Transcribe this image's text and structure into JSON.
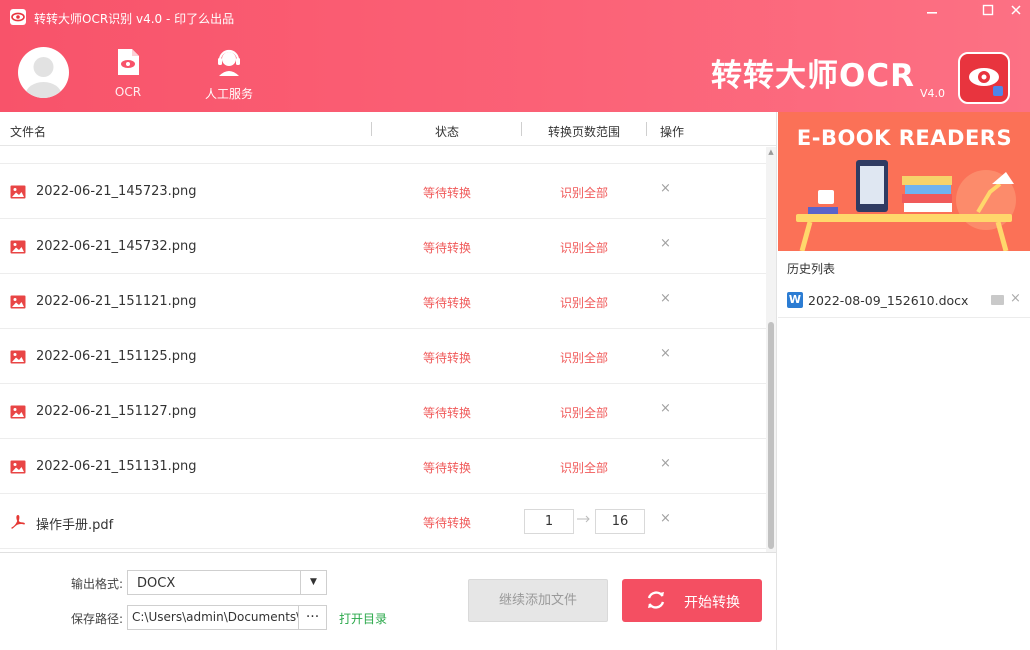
{
  "window": {
    "title": "转转大师OCR识别 v4.0 - 印了么出品",
    "minimize_icon": "minimize-icon",
    "maximize_icon": "maximize-icon",
    "close_icon": "close-icon"
  },
  "header": {
    "nav": [
      {
        "label": "OCR",
        "icon": "document-eye-icon"
      },
      {
        "label": "人工服务",
        "icon": "headset-icon"
      }
    ],
    "brand": {
      "title": "转转大师OCR",
      "version": "V4.0"
    }
  },
  "colors": {
    "accent": "#f44f62",
    "status_red": "#f05a5a",
    "link_green": "#2aa84a",
    "banner_orange": "#fb7157"
  },
  "table": {
    "headers": {
      "name": "文件名",
      "status": "状态",
      "range": "转换页数范围",
      "action": "操作"
    },
    "rows": [
      {
        "name": "2022-06-21_145723.png",
        "type": "image",
        "status": "等待转换",
        "range": "识别全部"
      },
      {
        "name": "2022-06-21_145732.png",
        "type": "image",
        "status": "等待转换",
        "range": "识别全部"
      },
      {
        "name": "2022-06-21_151121.png",
        "type": "image",
        "status": "等待转换",
        "range": "识别全部"
      },
      {
        "name": "2022-06-21_151125.png",
        "type": "image",
        "status": "等待转换",
        "range": "识别全部"
      },
      {
        "name": "2022-06-21_151127.png",
        "type": "image",
        "status": "等待转换",
        "range": "识别全部"
      },
      {
        "name": "2022-06-21_151131.png",
        "type": "image",
        "status": "等待转换",
        "range": "识别全部"
      },
      {
        "name": "操作手册.pdf",
        "type": "pdf",
        "status": "等待转换",
        "range_from": "1",
        "range_to": "16"
      }
    ],
    "delete_symbol": "×"
  },
  "bottom": {
    "format_label": "输出格式:",
    "format_value": "DOCX",
    "path_label": "保存路径:",
    "path_value": "C:\\Users\\admin\\Documents\\",
    "path_more": "···",
    "open_dir": "打开目录",
    "add_button": "继续添加文件",
    "start_button": "开始转换"
  },
  "sidebar": {
    "banner_title": "E-BOOK READERS",
    "history_title": "历史列表",
    "history": [
      {
        "name": "2022-08-09_152610.docx",
        "icon": "word-icon",
        "icon_letter": "W"
      }
    ],
    "delete_symbol": "×"
  }
}
